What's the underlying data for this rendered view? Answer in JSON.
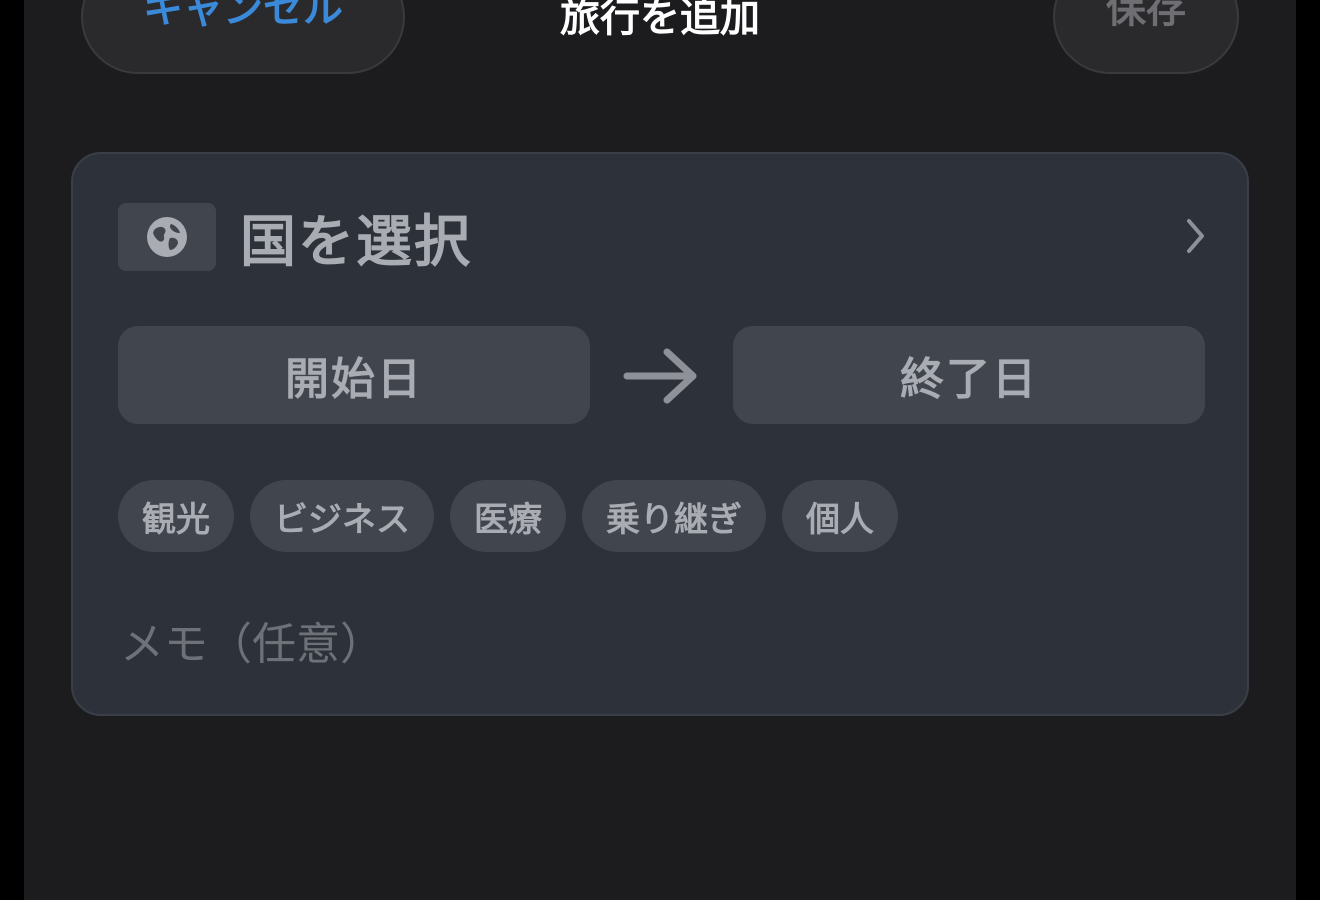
{
  "nav": {
    "cancel_label": "キャンセル",
    "title": "旅行を追加",
    "save_label": "保存"
  },
  "form": {
    "country_label": "国を選択",
    "start_date_label": "開始日",
    "end_date_label": "終了日",
    "purposes": [
      "観光",
      "ビジネス",
      "医療",
      "乗り継ぎ",
      "個人"
    ],
    "memo_placeholder": "メモ（任意）"
  },
  "icons": {
    "country": "globe-icon",
    "disclosure": "chevron-right-icon",
    "date_range": "arrow-right-icon"
  },
  "colors": {
    "accent": "#3a8ad9",
    "background": "#1c1c1e",
    "card": "#2d323a",
    "control": "#40454e"
  }
}
